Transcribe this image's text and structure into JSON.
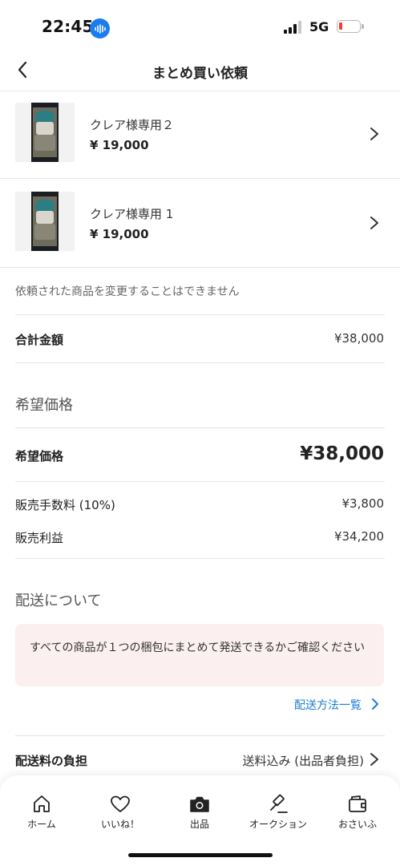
{
  "status_bar": {
    "time": "22:45",
    "network": "5G",
    "battery_level": 0.1,
    "signal_bars": 3
  },
  "header": {
    "title": "まとめ買い依頼"
  },
  "products": [
    {
      "name": "クレア様専用２",
      "price": "¥ 19,000"
    },
    {
      "name": "クレア様専用 1",
      "price": "¥ 19,000"
    }
  ],
  "notice": "依頼された商品を変更することはできません",
  "total": {
    "label": "合計金額",
    "value": "¥38,000"
  },
  "desired_section": {
    "heading": "希望価格",
    "desired_label": "希望価格",
    "desired_value": "¥38,000",
    "fee_label": "販売手数料 (10%)",
    "fee_value": "¥3,800",
    "profit_label": "販売利益",
    "profit_value": "¥34,200"
  },
  "shipping_section": {
    "heading": "配送について",
    "alert": "すべての商品が１つの梱包にまとめて発送できるかご確認ください",
    "link": "配送方法一覧",
    "burden_label": "配送料の負担",
    "burden_value": "送料込み (出品者負担)"
  },
  "tabbar": {
    "tabs": [
      {
        "label": "ホーム",
        "icon": "home-icon"
      },
      {
        "label": "いいね！",
        "icon": "heart-icon"
      },
      {
        "label": "出品",
        "icon": "camera-icon"
      },
      {
        "label": "オークション",
        "icon": "gavel-icon"
      },
      {
        "label": "おさいふ",
        "icon": "wallet-icon"
      }
    ]
  },
  "colors": {
    "accent_link": "#1a7cd2",
    "alert_bg": "#fbeff0",
    "battery_low": "#ff3b30",
    "recording": "#1a7cf0"
  }
}
